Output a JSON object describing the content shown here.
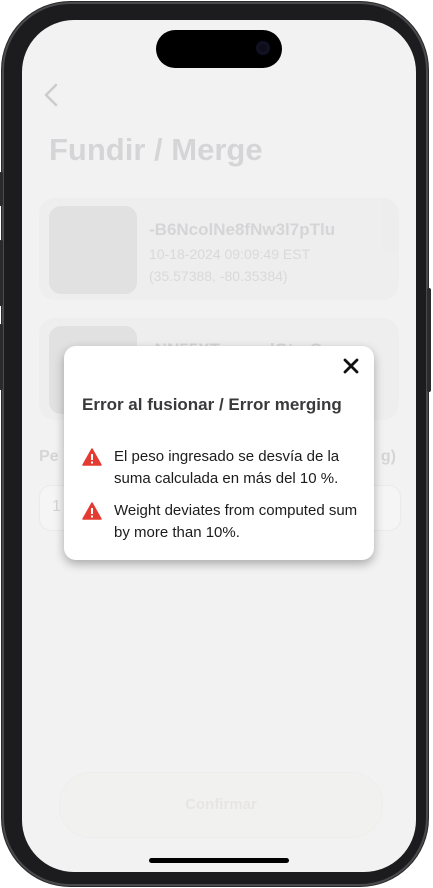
{
  "colors": {
    "warning": "#e33b32",
    "modal_bg": "#ffffff",
    "screen_bg": "#f2f2f2"
  },
  "background_screen": {
    "back_icon": "chevron-left-icon",
    "title": "Fundir / Merge",
    "cards": [
      {
        "id": "-B6NcolNe8fNw3l7pTlu",
        "date": "10-18-2024 09:09:49 EST",
        "coords": "(35.57388, -80.35384)"
      },
      {
        "id": "-NN55XT_pucqlQterO",
        "date": "",
        "coords": ""
      }
    ],
    "weight_label": "Pe",
    "weight_unit": "g)",
    "weight_value": "1",
    "confirm_label": "Confirmar"
  },
  "modal": {
    "close_icon": "close-icon",
    "title": "Error al fusionar / Error merging",
    "messages": [
      {
        "icon": "warning-icon",
        "text": "El peso ingresado se desvía de la suma calculada en más del 10 %."
      },
      {
        "icon": "warning-icon",
        "text": "Weight deviates from computed sum by more than 10%."
      }
    ]
  }
}
